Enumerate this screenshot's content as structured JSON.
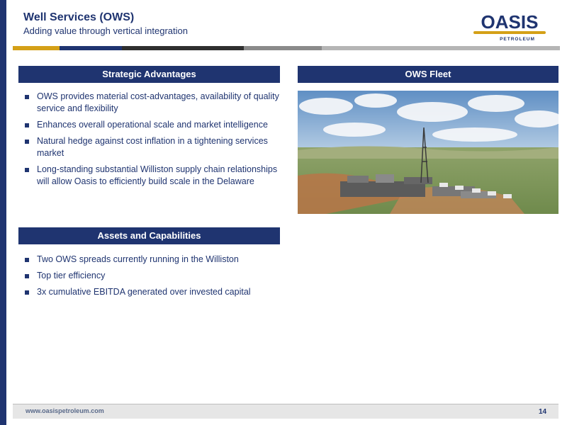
{
  "header": {
    "title": "Well Services (OWS)",
    "subtitle": "Adding value through vertical integration"
  },
  "logo": {
    "name": "OASIS",
    "tagline": "PETROLEUM",
    "colors": {
      "primary": "#1f3470",
      "accent": "#d4a017"
    }
  },
  "stripe_colors": [
    "#d4a017",
    "#1f3470",
    "#2f2f2f",
    "#8a8a8a",
    "#b5b5b5"
  ],
  "strategic_advantages": {
    "heading": "Strategic Advantages",
    "bullets": [
      "OWS provides material cost-advantages, availability of quality service and flexibility",
      "Enhances overall operational scale and market intelligence",
      "Natural hedge against cost inflation in a tightening services market",
      "Long-standing substantial Williston supply chain relationships will allow Oasis to efficiently build scale in the Delaware"
    ]
  },
  "ows_fleet": {
    "heading": "OWS Fleet"
  },
  "assets_capabilities": {
    "heading": "Assets and Capabilities",
    "bullets": [
      "Two OWS spreads currently running in the Williston",
      "Top tier efficiency",
      "3x cumulative EBITDA generated over invested capital"
    ]
  },
  "footer": {
    "url": "www.oasispetroleum.com",
    "page_number": "14"
  },
  "theme": {
    "navy": "#1f3470",
    "gold": "#d4a017"
  }
}
